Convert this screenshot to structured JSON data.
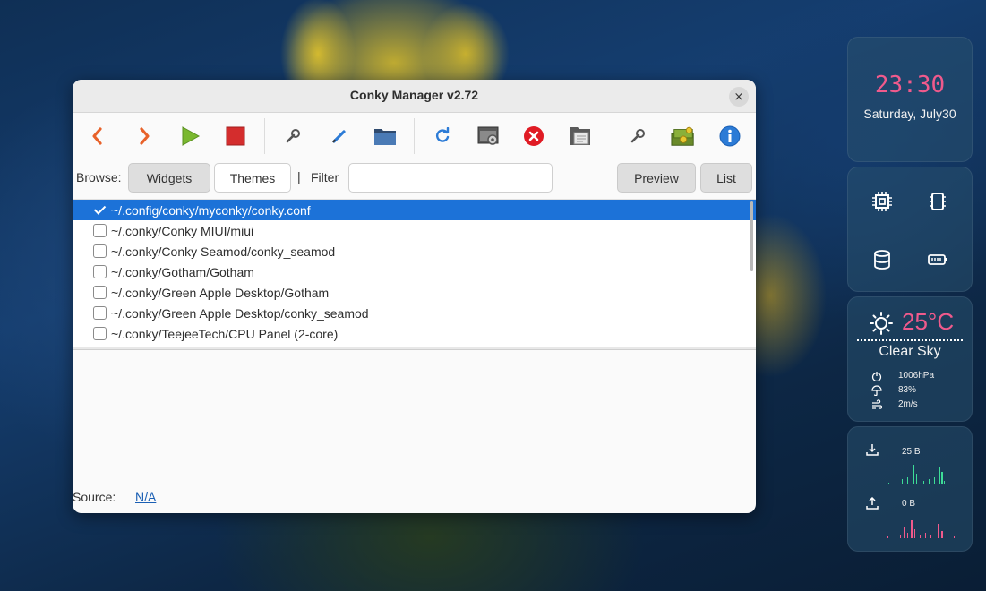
{
  "window": {
    "title": "Conky Manager v2.72",
    "close_glyph": "×"
  },
  "toolbar": {
    "icons": [
      "back-arrow-icon",
      "forward-arrow-icon",
      "play-icon",
      "stop-icon",
      "wrench-icon",
      "pencil-icon",
      "folder-icon",
      "refresh-icon",
      "settings-window-icon",
      "delete-icon",
      "file-manager-icon",
      "tools-icon",
      "donate-money-icon",
      "info-icon"
    ],
    "colors": {
      "arrow": "#e8622a",
      "play": "#7ab82f",
      "stop": "#d42d2d",
      "blue": "#2c7bd6",
      "red": "#e01b24"
    }
  },
  "browse": {
    "label": "Browse:",
    "widgets_label": "Widgets",
    "themes_label": "Themes",
    "pipe": "|",
    "filter_label": "Filter",
    "filter_value": "",
    "preview_label": "Preview",
    "list_label": "List"
  },
  "items": [
    {
      "path": "~/.config/conky/myconky/conky.conf",
      "checked": true
    },
    {
      "path": "~/.conky/Conky MIUI/miui",
      "checked": false
    },
    {
      "path": "~/.conky/Conky Seamod/conky_seamod",
      "checked": false
    },
    {
      "path": "~/.conky/Gotham/Gotham",
      "checked": false
    },
    {
      "path": "~/.conky/Green Apple Desktop/Gotham",
      "checked": false
    },
    {
      "path": "~/.conky/Green Apple Desktop/conky_seamod",
      "checked": false
    },
    {
      "path": "~/.conky/TeejeeTech/CPU Panel (2-core)",
      "checked": false
    }
  ],
  "source": {
    "label": "Source:",
    "value": "N/A"
  },
  "widgets": {
    "clock": {
      "time": "23:30",
      "date": "Saturday, July30",
      "color": "#f05a8c"
    },
    "hardware": {
      "icons": [
        "cpu-icon",
        "memory-icon",
        "disk-icon",
        "battery-icon"
      ]
    },
    "weather": {
      "temperature": "25°C",
      "condition": "Clear Sky",
      "pressure": "1006hPa",
      "humidity": "83%",
      "wind": "2m/s"
    },
    "network": {
      "download": "25 B",
      "upload": "0 B",
      "download_color": "#3ddc97",
      "upload_color": "#f05a8c"
    }
  }
}
